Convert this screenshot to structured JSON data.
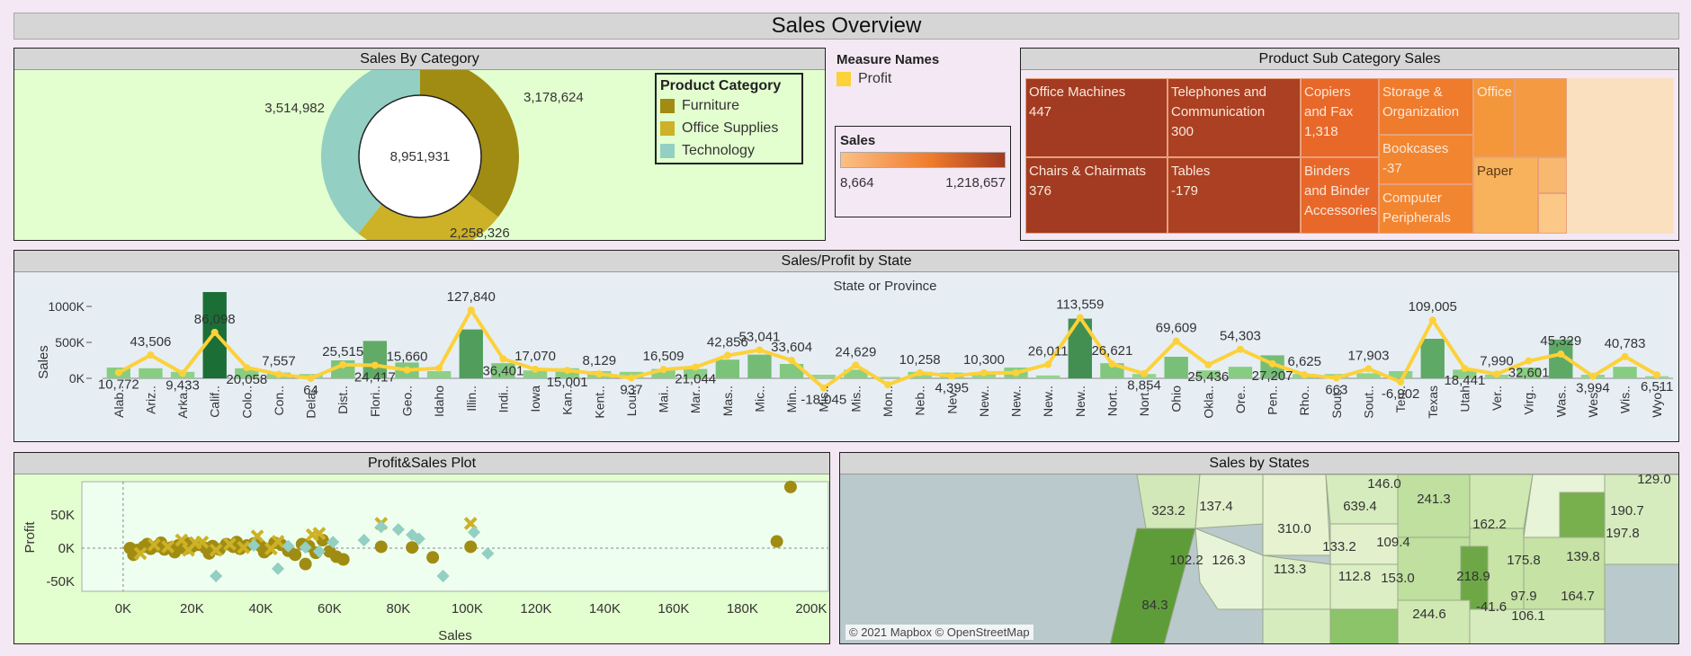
{
  "dashboard_title": "Sales Overview",
  "category_panel": {
    "title": "Sales By Category",
    "total_label": "8,951,931",
    "legend_title": "Product Category"
  },
  "measure_legend": {
    "title": "Measure Names",
    "item": "Profit",
    "item_color": "#fcd13a"
  },
  "sales_legend": {
    "title": "Sales",
    "min_label": "8,664",
    "max_label": "1,218,657"
  },
  "subcategory_panel": {
    "title": "Product Sub Category Sales"
  },
  "state_panel": {
    "title": "Sales/Profit by State"
  },
  "scatter_panel": {
    "title": "Profit&Sales Plot"
  },
  "map_panel": {
    "title": "Sales by States",
    "attribution": "© 2021 Mapbox © OpenStreetMap"
  },
  "chart_data": [
    {
      "type": "pie",
      "title": "Sales By Category",
      "center_label": "8,951,931",
      "legend_title": "Product Category",
      "slices": [
        {
          "label": "Furniture",
          "value": 3178624,
          "value_label": "3,178,624",
          "color": "#a08c12"
        },
        {
          "label": "Office Supplies",
          "value": 2258326,
          "value_label": "2,258,326",
          "color": "#cdb126"
        },
        {
          "label": "Technology",
          "value": 3514982,
          "value_label": "3,514,982",
          "color": "#93cfc2"
        }
      ]
    },
    {
      "type": "heatmap",
      "title": "Product Sub Category Sales",
      "subtype": "treemap",
      "cells": [
        {
          "label": "Office Machines",
          "value_label": "447",
          "color": "#a23b22"
        },
        {
          "label": "Chairs & Chairmats",
          "value_label": "376",
          "color": "#a23b22"
        },
        {
          "label": "Telephones and Communication",
          "value_label": "300",
          "color": "#ab4023"
        },
        {
          "label": "Tables",
          "value_label": "-179",
          "color": "#ab4023"
        },
        {
          "label": "Copiers and Fax",
          "value_label": "1,318",
          "color": "#e8682a"
        },
        {
          "label": "Binders and Binder Accessories",
          "value_label": "",
          "color": "#e8682a"
        },
        {
          "label": "Storage & Organization",
          "value_label": "",
          "color": "#ef7b2c"
        },
        {
          "label": "Bookcases",
          "value_label": "-37",
          "color": "#f28530"
        },
        {
          "label": "Computer Peripherals",
          "value_label": "",
          "color": "#f28530"
        },
        {
          "label": "Office",
          "value_label": "",
          "color": "#f4963a"
        },
        {
          "label": "Paper",
          "value_label": "",
          "color": "#f8b25c"
        }
      ]
    },
    {
      "type": "bar",
      "title": "Sales/Profit by State",
      "xlabel": "State or Province",
      "ylabel": "Sales",
      "ylim": [
        -250000,
        1250000
      ],
      "yticks": [
        "1000K",
        "500K",
        "0K"
      ],
      "categories": [
        "Alab..",
        "Ariz..",
        "Arka..",
        "Calif..",
        "Colo..",
        "Con..",
        "Dela..",
        "Dist..",
        "Flori..",
        "Geo..",
        "Idaho",
        "Illin..",
        "Indi..",
        "Iowa",
        "Kan..",
        "Kent..",
        "Loui..",
        "Mai..",
        "Mar..",
        "Mas..",
        "Mic..",
        "Min..",
        "Mis..",
        "Mis..",
        "Mon..",
        "Neb..",
        "Nev..",
        "New..",
        "New..",
        "New..",
        "New..",
        "Nort..",
        "Nort..",
        "Ohio",
        "Okla..",
        "Ore..",
        "Pen..",
        "Rho..",
        "Sout..",
        "Sout..",
        "Ten..",
        "Texas",
        "Utah",
        "Ver..",
        "Virg..",
        "Was..",
        "Wes..",
        "Wis..",
        "Wyo.."
      ],
      "series": [
        {
          "name": "Sales",
          "values": [
            150000,
            140000,
            90000,
            1200000,
            140000,
            80000,
            60000,
            250000,
            520000,
            220000,
            100000,
            680000,
            210000,
            110000,
            140000,
            100000,
            90000,
            130000,
            130000,
            260000,
            330000,
            200000,
            50000,
            120000,
            20000,
            90000,
            80000,
            60000,
            150000,
            40000,
            830000,
            210000,
            60000,
            300000,
            110000,
            160000,
            320000,
            60000,
            60000,
            70000,
            100000,
            550000,
            120000,
            50000,
            150000,
            540000,
            50000,
            160000,
            30000
          ]
        },
        {
          "name": "Profit",
          "values": [
            10772,
            43506,
            9433,
            86098,
            20058,
            7557,
            64,
            25515,
            24417,
            15660,
            19000,
            127840,
            36401,
            17070,
            15001,
            8129,
            937,
            16509,
            21044,
            42856,
            53041,
            33604,
            -18045,
            24629,
            -12000,
            10258,
            4395,
            10300,
            10300,
            26011,
            113559,
            26621,
            8854,
            69609,
            25436,
            54303,
            27207,
            6625,
            663,
            17903,
            -6902,
            109005,
            18441,
            7990,
            32601,
            45329,
            3994,
            40783,
            6511
          ]
        }
      ],
      "profit_labels": [
        "10,772",
        "43,506",
        "9,433",
        "86,098",
        "20,058",
        "7,557",
        "64",
        "25,515",
        "24,417",
        "15,660",
        "",
        "127,840",
        "36,401",
        "17,070",
        "15,001",
        "8,129",
        "937",
        "16,509",
        "21,044",
        "42,856",
        "53,041",
        "33,604",
        "-18,045",
        "24,629",
        "",
        "10,258",
        "4,395",
        "10,300",
        "",
        "26,011",
        "113,559",
        "26,621",
        "8,854",
        "69,609",
        "25,436",
        "54,303",
        "27,207",
        "6,625",
        "663",
        "17,903",
        "-6,902",
        "109,005",
        "18,441",
        "7,990",
        "32,601",
        "45,329",
        "3,994",
        "40,783",
        "6,511"
      ]
    },
    {
      "type": "scatter",
      "title": "Profit&Sales Plot",
      "xlabel": "Sales",
      "ylabel": "Profit",
      "xlim": [
        -12000,
        205000
      ],
      "ylim": [
        -65000,
        100000
      ],
      "xticks": [
        "0K",
        "20K",
        "40K",
        "60K",
        "80K",
        "100K",
        "120K",
        "140K",
        "160K",
        "180K",
        "200K"
      ],
      "yticks": [
        "50K",
        "0K",
        "-50K"
      ],
      "series": [
        {
          "name": "Furniture",
          "color": "#a08c12",
          "points": [
            [
              2000,
              0
            ],
            [
              4000,
              -3000
            ],
            [
              6000,
              2000
            ],
            [
              8000,
              -1000
            ],
            [
              10000,
              3000
            ],
            [
              12000,
              -2000
            ],
            [
              14000,
              1000
            ],
            [
              16000,
              4000
            ],
            [
              18000,
              -1000
            ],
            [
              20000,
              2000
            ],
            [
              22000,
              5000
            ],
            [
              24000,
              0
            ],
            [
              26000,
              3000
            ],
            [
              28000,
              -2000
            ],
            [
              30000,
              6000
            ],
            [
              32000,
              2000
            ],
            [
              34000,
              -1000
            ],
            [
              36000,
              4000
            ],
            [
              38000,
              7000
            ],
            [
              40000,
              3000
            ],
            [
              42000,
              -2000
            ],
            [
              44000,
              8000
            ],
            [
              46000,
              5000
            ],
            [
              48000,
              -4000
            ],
            [
              50000,
              -10000
            ],
            [
              52000,
              6000
            ],
            [
              54000,
              3000
            ],
            [
              56000,
              -7000
            ],
            [
              58000,
              12000
            ],
            [
              60000,
              -5000
            ],
            [
              62000,
              -13000
            ],
            [
              64000,
              -17000
            ],
            [
              75000,
              2000
            ],
            [
              84000,
              1000
            ],
            [
              90000,
              -14000
            ],
            [
              101000,
              2000
            ],
            [
              190000,
              10000
            ],
            [
              194000,
              92000
            ],
            [
              3000,
              -10000
            ],
            [
              7000,
              6000
            ],
            [
              11000,
              8000
            ],
            [
              15000,
              -6000
            ],
            [
              19000,
              7000
            ],
            [
              25000,
              -8000
            ],
            [
              33000,
              9000
            ],
            [
              41000,
              -6000
            ],
            [
              53000,
              -24000
            ]
          ]
        },
        {
          "name": "Office Supplies",
          "color": "#cdb126",
          "points": [
            [
              5000,
              -8000
            ],
            [
              9000,
              5000
            ],
            [
              13000,
              2000
            ],
            [
              17000,
              12000
            ],
            [
              21000,
              8000
            ],
            [
              27000,
              -3000
            ],
            [
              31000,
              6000
            ],
            [
              35000,
              1000
            ],
            [
              39000,
              18000
            ],
            [
              45000,
              10000
            ],
            [
              55000,
              20000
            ],
            [
              57000,
              22000
            ],
            [
              75000,
              37000
            ],
            [
              101000,
              37000
            ],
            [
              19000,
              -3000
            ],
            [
              23000,
              9000
            ],
            [
              43000,
              -1000
            ]
          ]
        },
        {
          "name": "Technology",
          "color": "#93cfc2",
          "points": [
            [
              27000,
              -42000
            ],
            [
              45000,
              -31000
            ],
            [
              48000,
              3000
            ],
            [
              53000,
              1000
            ],
            [
              57000,
              -5000
            ],
            [
              70000,
              12000
            ],
            [
              75000,
              32000
            ],
            [
              80000,
              28000
            ],
            [
              84000,
              20000
            ],
            [
              86000,
              14000
            ],
            [
              93000,
              -42000
            ],
            [
              102000,
              24000
            ],
            [
              106000,
              -8000
            ],
            [
              38000,
              4000
            ],
            [
              61000,
              9000
            ]
          ]
        }
      ]
    }
  ],
  "map_labels": [
    "323.2",
    "137.4",
    "310.0",
    "639.4",
    "241.3",
    "129.0",
    "162.2",
    "190.7",
    "197.8",
    "133.2",
    "109.4",
    "102.2",
    "126.3",
    "113.3",
    "112.8",
    "153.0",
    "218.9",
    "175.8",
    "139.8",
    "84.3",
    "244.6",
    "97.9",
    "164.7",
    "-41.6",
    "106.1",
    "146.0"
  ]
}
